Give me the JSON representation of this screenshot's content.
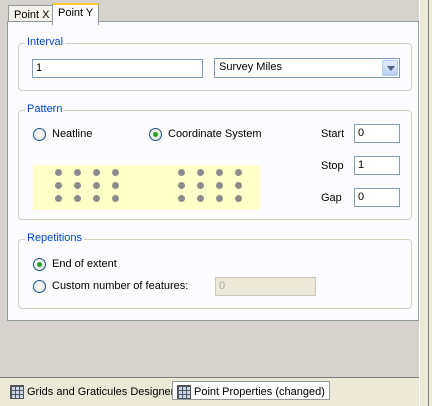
{
  "tabs": [
    {
      "label": "Point X"
    },
    {
      "label": "Point Y"
    }
  ],
  "interval": {
    "legend": "Interval",
    "value": "1",
    "unit": "Survey Miles"
  },
  "pattern": {
    "legend": "Pattern",
    "options": [
      {
        "label": "Neatline",
        "checked": false
      },
      {
        "label": "Coordinate System",
        "checked": true
      }
    ],
    "start_label": "Start",
    "start_value": "0",
    "stop_label": "Stop",
    "stop_value": "1",
    "gap_label": "Gap",
    "gap_value": "0",
    "preview_color": "#ffffc8",
    "dot_color": "#8c8c8c"
  },
  "repetitions": {
    "legend": "Repetitions",
    "options": [
      {
        "label": "End of extent",
        "checked": true
      },
      {
        "label": "Custom number of features:",
        "checked": false
      }
    ],
    "custom_value": "0"
  },
  "bottom_tabs": [
    {
      "label": "Grids and Graticules Designer",
      "icon": "grid-designer-icon"
    },
    {
      "label": "Point Properties (changed)",
      "icon": "point-properties-icon"
    }
  ],
  "colors": {
    "legend_text": "#0046d5",
    "active_tab_accent": "#ffc83c",
    "radio_dot": "#21a121"
  }
}
